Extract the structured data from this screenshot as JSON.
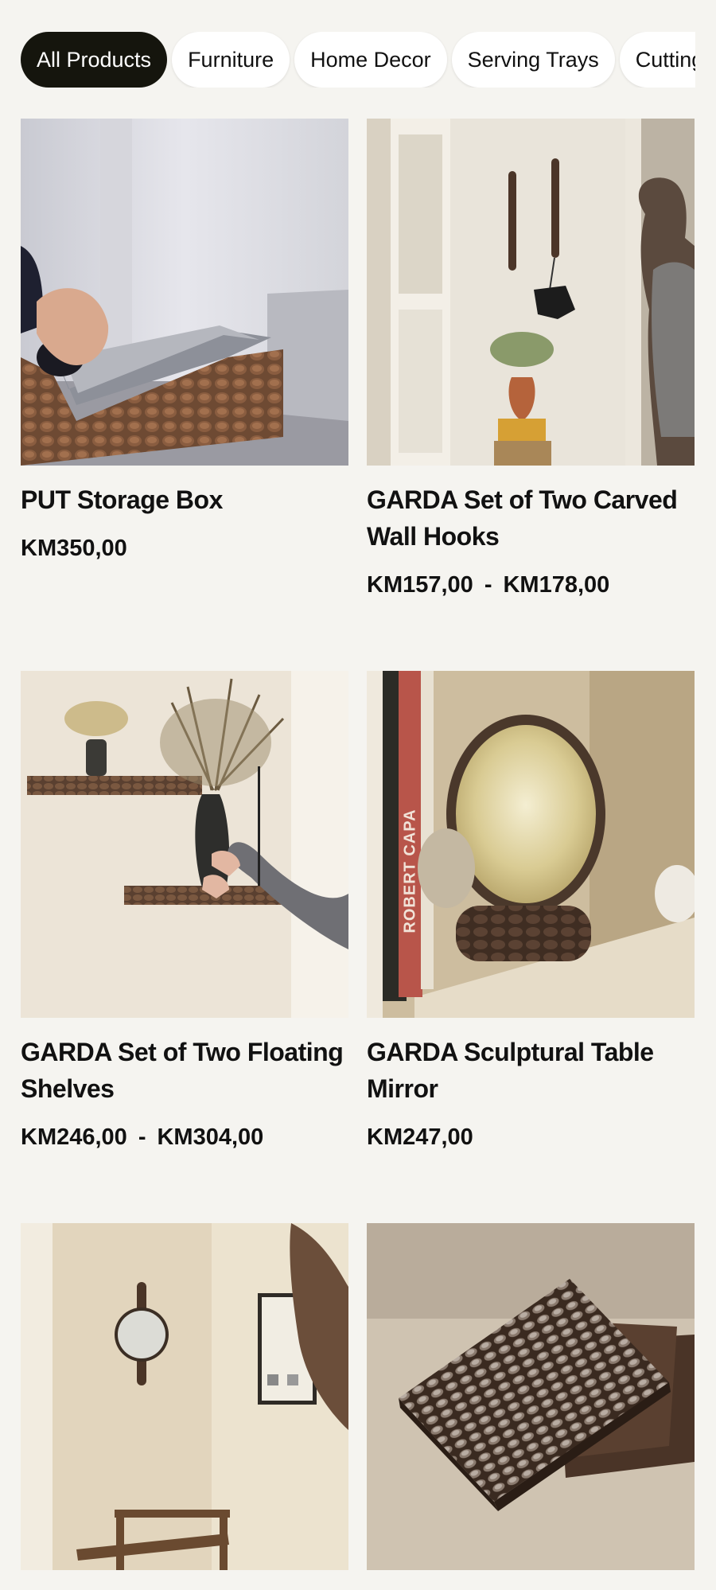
{
  "filters": [
    {
      "label": "All Products",
      "active": true
    },
    {
      "label": "Furniture",
      "active": false
    },
    {
      "label": "Home Decor",
      "active": false
    },
    {
      "label": "Serving Trays",
      "active": false
    },
    {
      "label": "Cutting Boards",
      "active": false
    }
  ],
  "products": [
    {
      "title": "PUT Storage Box",
      "price": "KM350,00",
      "price_max": ""
    },
    {
      "title": "GARDA Set of Two Carved Wall Hooks",
      "price": "KM157,00",
      "price_max": "KM178,00"
    },
    {
      "title": "GARDA Set of Two Floating Shelves",
      "price": "KM246,00",
      "price_max": "KM304,00"
    },
    {
      "title": "GARDA Sculptural Table Mirror",
      "price": "KM247,00",
      "price_max": ""
    },
    {
      "title": "",
      "price": "",
      "price_max": ""
    },
    {
      "title": "",
      "price": "",
      "price_max": ""
    }
  ],
  "price_separator": "-",
  "book_spine_text": "ROBERT CAPA",
  "colors": {
    "background": "#f5f4f0",
    "active_chip": "#15150d",
    "chip": "#ffffff",
    "text": "#111111"
  }
}
